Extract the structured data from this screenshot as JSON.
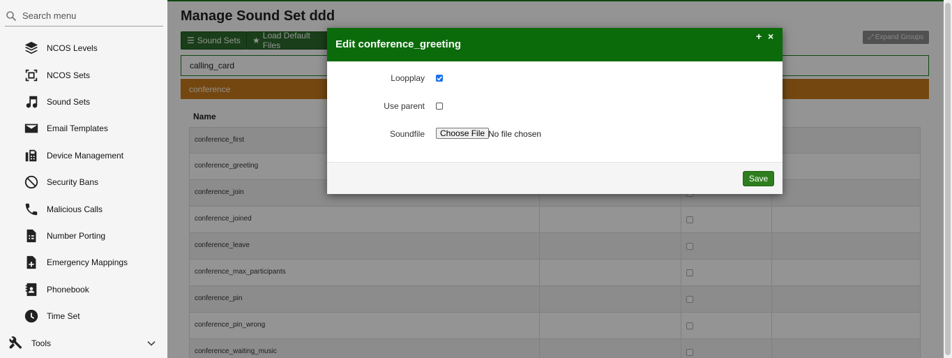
{
  "sidebar": {
    "search_placeholder": "Search menu",
    "items": [
      {
        "label": "NCOS Levels",
        "icon": "layers-icon"
      },
      {
        "label": "NCOS Sets",
        "icon": "select-frame-icon"
      },
      {
        "label": "Sound Sets",
        "icon": "music-note-icon"
      },
      {
        "label": "Email Templates",
        "icon": "envelope-icon"
      },
      {
        "label": "Device Management",
        "icon": "fax-icon"
      },
      {
        "label": "Security Bans",
        "icon": "ban-icon"
      },
      {
        "label": "Malicious Calls",
        "icon": "phone-icon"
      },
      {
        "label": "Number Porting",
        "icon": "sim-card-icon"
      },
      {
        "label": "Emergency Mappings",
        "icon": "medical-file-icon"
      },
      {
        "label": "Phonebook",
        "icon": "contact-book-icon"
      },
      {
        "label": "Time Set",
        "icon": "clock-icon"
      }
    ],
    "tools_label": "Tools"
  },
  "main": {
    "title": "Manage Sound Set ddd",
    "buttons": {
      "sound_sets": "Sound Sets",
      "load_default": "Load Default Files",
      "expand_groups": "Expand Groups"
    },
    "groups": {
      "calling_card": "calling_card",
      "conference": "conference"
    },
    "table": {
      "name_header": "Name",
      "rows": [
        "conference_first",
        "conference_greeting",
        "conference_join",
        "conference_joined",
        "conference_leave",
        "conference_max_participants",
        "conference_pin",
        "conference_pin_wrong",
        "conference_waiting_music"
      ]
    }
  },
  "modal": {
    "title": "Edit conference_greeting",
    "expand_glyph": "+",
    "close_glyph": "×",
    "fields": {
      "loopplay_label": "Loopplay",
      "loopplay_checked": true,
      "use_parent_label": "Use parent",
      "use_parent_checked": false,
      "soundfile_label": "Soundfile",
      "choose_file": "Choose File",
      "no_file": "No file chosen"
    },
    "save_label": "Save"
  },
  "colors": {
    "header_green": "#0b6b0b",
    "button_green": "#2b6b2b",
    "conference_orange": "#c97a1e",
    "checkbox_blue": "#1a73e8"
  }
}
